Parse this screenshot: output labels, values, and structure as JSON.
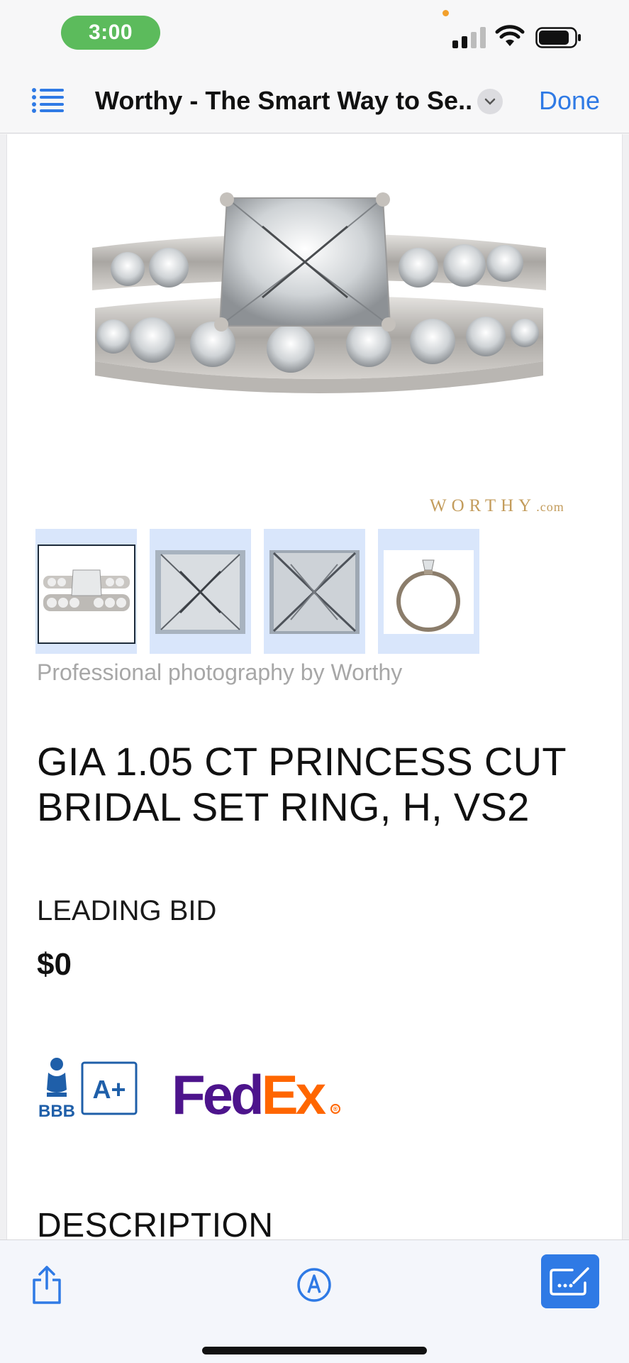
{
  "status_bar": {
    "time": "3:00"
  },
  "nav": {
    "title": "Worthy - The Smart Way to Se...",
    "done_label": "Done"
  },
  "product": {
    "watermark": "WORTHY",
    "watermark_suffix": ".com",
    "thumbnails": [
      "ring-front-view",
      "princess-stone-top",
      "princess-stone-detail",
      "ring-side-view"
    ],
    "selected_thumbnail": 0,
    "photo_caption": "Professional photography by Worthy",
    "title": "GIA 1.05 CT PRINCESS CUT BRIDAL SET RING, H, VS2",
    "leading_bid_label": "LEADING BID",
    "leading_bid_value": "$0"
  },
  "badges": {
    "bbb_label": "BBB",
    "bbb_rating": "A+",
    "fedex_fed": "Fed",
    "fedex_ex": "Ex"
  },
  "sections": {
    "description_heading": "DESCRIPTION"
  },
  "icons": {
    "list": "list-icon",
    "chevron": "chevron-down-icon",
    "share": "share-icon",
    "markup": "markup-icon",
    "compose": "compose-icon"
  },
  "colors": {
    "accent": "#2f7ae5",
    "time_pill": "#5cbb5c",
    "watermark_gold": "#c39c5c",
    "fedex_purple": "#4d148c",
    "fedex_orange": "#ff6600",
    "bbb_blue": "#1f5fa9"
  }
}
